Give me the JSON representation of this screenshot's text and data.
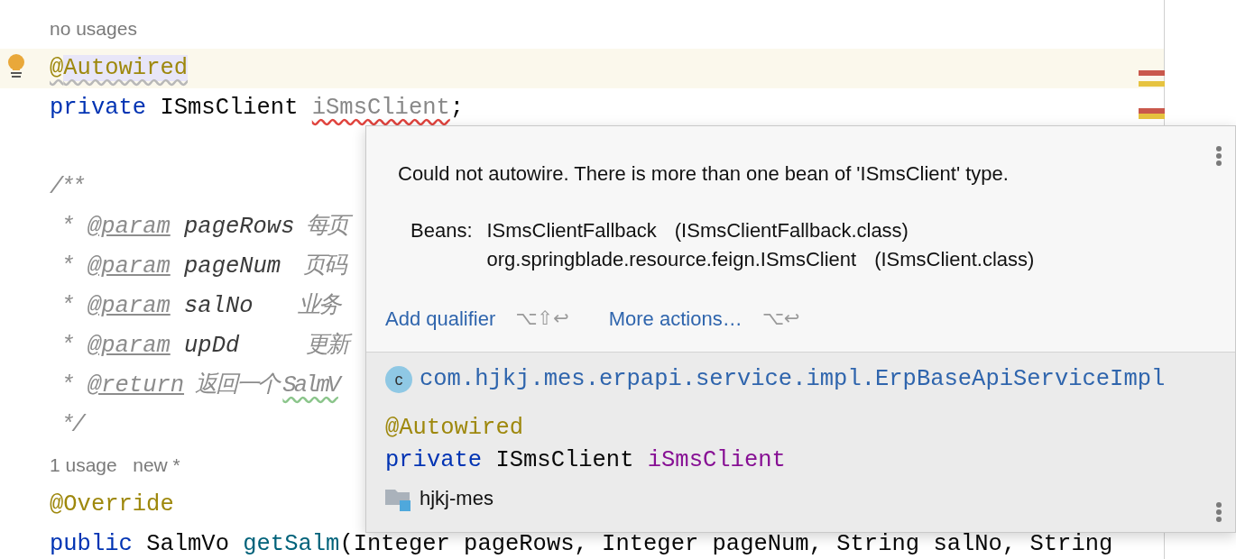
{
  "editor": {
    "lines": [
      {
        "kind": "hint",
        "text": "no usages"
      },
      {
        "kind": "code",
        "highlighted": true,
        "intention_bulb": true,
        "tokens": [
          {
            "text": "@",
            "kind": "annotation",
            "weak_warning": true
          },
          {
            "text": "Autowired",
            "kind": "annotation",
            "weak_warning": true,
            "selected": true
          }
        ]
      },
      {
        "kind": "code",
        "tokens": [
          {
            "text": "private",
            "kind": "keyword"
          },
          {
            "text": " ISmsClient ",
            "kind": "plain"
          },
          {
            "text": "iSmsClient",
            "kind": "unused",
            "error": true
          },
          {
            "text": ";",
            "kind": "plain"
          }
        ]
      },
      {
        "kind": "blank"
      },
      {
        "kind": "code",
        "tokens": [
          {
            "text": "/**",
            "kind": "comment"
          }
        ]
      },
      {
        "kind": "code",
        "tokens": [
          {
            "text": " * ",
            "kind": "comment"
          },
          {
            "text": "@param",
            "kind": "doctag"
          },
          {
            "text": " pageRows",
            "kind": "docparam"
          },
          {
            "text": " 每页",
            "kind": "comment"
          }
        ]
      },
      {
        "kind": "code",
        "tokens": [
          {
            "text": " * ",
            "kind": "comment"
          },
          {
            "text": "@param",
            "kind": "doctag"
          },
          {
            "text": " pageNum",
            "kind": "docparam"
          },
          {
            "text": "  页码",
            "kind": "comment"
          }
        ]
      },
      {
        "kind": "code",
        "tokens": [
          {
            "text": " * ",
            "kind": "comment"
          },
          {
            "text": "@param",
            "kind": "doctag"
          },
          {
            "text": " salNo",
            "kind": "docparam"
          },
          {
            "text": "    业务",
            "kind": "comment"
          }
        ]
      },
      {
        "kind": "code",
        "tokens": [
          {
            "text": " * ",
            "kind": "comment"
          },
          {
            "text": "@param",
            "kind": "doctag"
          },
          {
            "text": " upDd",
            "kind": "docparam"
          },
          {
            "text": "      更新",
            "kind": "comment"
          }
        ]
      },
      {
        "kind": "code",
        "tokens": [
          {
            "text": " * ",
            "kind": "comment"
          },
          {
            "text": "@return",
            "kind": "doctag"
          },
          {
            "text": " 返回一个",
            "kind": "comment"
          },
          {
            "text": "SalmV",
            "kind": "comment",
            "typo": true
          }
        ]
      },
      {
        "kind": "code",
        "tokens": [
          {
            "text": " */",
            "kind": "comment"
          }
        ]
      },
      {
        "kind": "hint",
        "text": "1 usage   new *"
      },
      {
        "kind": "code",
        "tokens": [
          {
            "text": "@Override",
            "kind": "annotation"
          }
        ]
      },
      {
        "kind": "code",
        "tokens": [
          {
            "text": "public",
            "kind": "keyword"
          },
          {
            "text": " SalmVo ",
            "kind": "plain"
          },
          {
            "text": "getSalm",
            "kind": "method"
          },
          {
            "text": "(Integer pageRows, Integer pageNum, String salNo, String",
            "kind": "plain"
          }
        ]
      }
    ],
    "error_stripe": [
      {
        "color": "#c9584c"
      },
      {
        "color": "#e6c33f"
      },
      {
        "color": "#c9584c"
      },
      {
        "color": "#e6c33f"
      }
    ]
  },
  "popup": {
    "message": "Could not autowire. There is more than one bean of 'ISmsClient' type.",
    "beans_label": "Beans:",
    "beans": [
      {
        "name": "ISmsClientFallback",
        "file": "(ISmsClientFallback.class)"
      },
      {
        "name": "org.springblade.resource.feign.ISmsClient",
        "file": "(ISmsClient.class)"
      }
    ],
    "actions": [
      {
        "label": "Add qualifier",
        "shortcut": "⌥⇧↩"
      },
      {
        "label": "More actions…",
        "shortcut": "⌥↩"
      }
    ],
    "class_icon_letter": "c",
    "class_name": "com.hjkj.mes.erpapi.service.impl.ErpBaseApiServiceImpl",
    "declaration": [
      [
        {
          "text": "@Autowired",
          "kind": "annotation"
        }
      ],
      [
        {
          "text": "private",
          "kind": "keyword"
        },
        {
          "text": " ISmsClient ",
          "kind": "plain"
        },
        {
          "text": "iSmsClient",
          "kind": "field"
        }
      ]
    ],
    "module": "hjkj-mes"
  }
}
